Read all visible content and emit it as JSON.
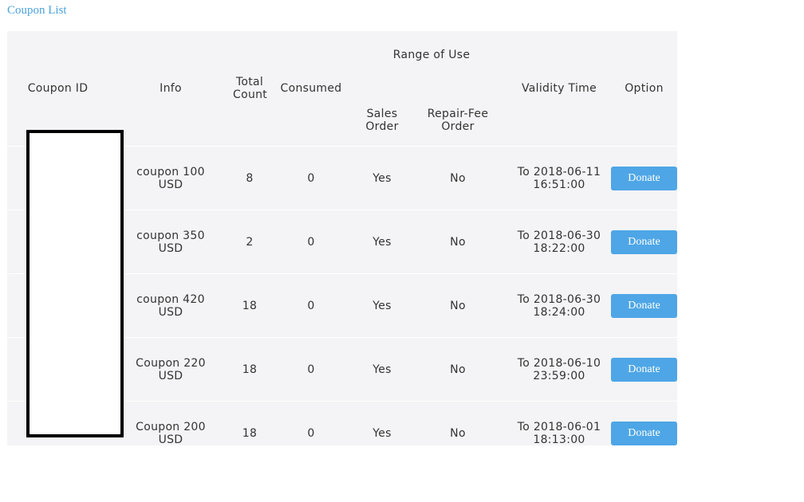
{
  "page": {
    "link_label": "Coupon List"
  },
  "table": {
    "headers": {
      "coupon_id": "Coupon ID",
      "info": "Info",
      "total_count_line1": "Total",
      "total_count_line2": "Count",
      "consumed": "Consumed",
      "range_of_use": "Range of Use",
      "sales_order_line1": "Sales",
      "sales_order_line2": "Order",
      "repair_fee_line1": "Repair-Fee",
      "repair_fee_line2": "Order",
      "validity_time": "Validity Time",
      "option": "Option"
    },
    "rows": [
      {
        "info_line1": "coupon 100",
        "info_line2": "USD",
        "total_count": "8",
        "consumed": "0",
        "sales_order": "Yes",
        "repair_fee_order": "No",
        "validity_line1": "To 2018-06-11",
        "validity_line2": "16:51:00",
        "option_label": "Donate"
      },
      {
        "info_line1": "coupon 350",
        "info_line2": "USD",
        "total_count": "2",
        "consumed": "0",
        "sales_order": "Yes",
        "repair_fee_order": "No",
        "validity_line1": "To 2018-06-30",
        "validity_line2": "18:22:00",
        "option_label": "Donate"
      },
      {
        "info_line1": "coupon 420",
        "info_line2": "USD",
        "total_count": "18",
        "consumed": "0",
        "sales_order": "Yes",
        "repair_fee_order": "No",
        "validity_line1": "To 2018-06-30",
        "validity_line2": "18:24:00",
        "option_label": "Donate"
      },
      {
        "info_line1": "Coupon 220",
        "info_line2": "USD",
        "total_count": "18",
        "consumed": "0",
        "sales_order": "Yes",
        "repair_fee_order": "No",
        "validity_line1": "To 2018-06-10",
        "validity_line2": "23:59:00",
        "option_label": "Donate"
      },
      {
        "info_line1": "Coupon 200",
        "info_line2": "USD",
        "total_count": "18",
        "consumed": "0",
        "sales_order": "Yes",
        "repair_fee_order": "No",
        "validity_line1": "To 2018-06-01",
        "validity_line2": "18:13:00",
        "option_label": "Donate"
      }
    ]
  },
  "colors": {
    "link": "#4aa2dc",
    "button": "#4ea6e6",
    "table_bg": "#f4f4f6",
    "redaction_border": "#000000"
  }
}
